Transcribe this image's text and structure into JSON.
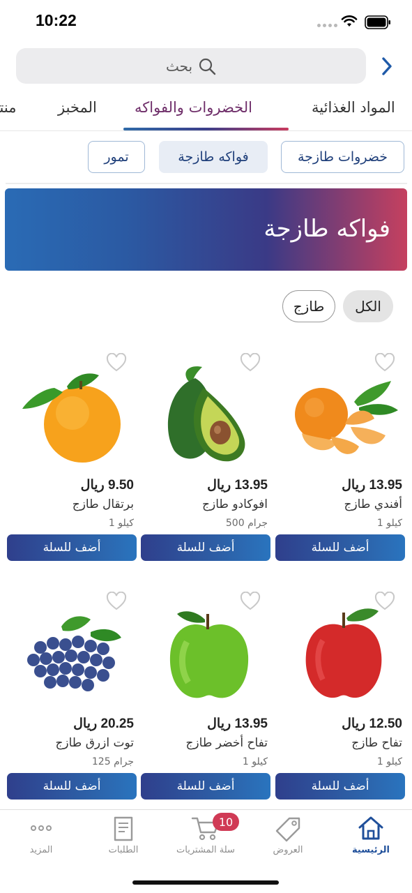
{
  "status_bar": {
    "time": "10:22"
  },
  "search": {
    "placeholder": "بحث"
  },
  "tabs": [
    {
      "label": "المواد الغذائية",
      "active": false
    },
    {
      "label": "الخضروات والفواكه",
      "active": true
    },
    {
      "label": "المخبز",
      "active": false
    },
    {
      "label": "منتج",
      "active": false
    }
  ],
  "subcategories": [
    {
      "label": "خضروات طازجة",
      "selected": false
    },
    {
      "label": "فواكه طازجة",
      "selected": true
    },
    {
      "label": "تمور",
      "selected": false
    }
  ],
  "banner": {
    "title": "فواكه طازجة"
  },
  "filters": {
    "all": "الكل",
    "fresh": "طازج"
  },
  "products": [
    {
      "name": "أفندي طازج",
      "price": "13.95 ريال",
      "qty": "1 كيلو",
      "image": "tangerine",
      "add_label": "أضف للسلة"
    },
    {
      "name": "افوكادو طازج",
      "price": "13.95 ريال",
      "qty": "500 جرام",
      "image": "avocado",
      "add_label": "أضف للسلة"
    },
    {
      "name": "برتقال طازج",
      "price": "9.50 ريال",
      "qty": "1 كيلو",
      "image": "orange",
      "add_label": "أضف للسلة"
    },
    {
      "name": "تفاح طازج",
      "price": "12.50 ريال",
      "qty": "1 كيلو",
      "image": "red-apple",
      "add_label": "أضف للسلة"
    },
    {
      "name": "تفاح أخضر طازج",
      "price": "13.95 ريال",
      "qty": "1 كيلو",
      "image": "green-apple",
      "add_label": "أضف للسلة"
    },
    {
      "name": "توت ازرق طازج",
      "price": "20.25 ريال",
      "qty": "125 جرام",
      "image": "blueberries",
      "add_label": "أضف للسلة"
    }
  ],
  "bottom_nav": {
    "items": [
      {
        "label": "الرئيسية",
        "icon": "home-icon",
        "active": true
      },
      {
        "label": "العروض",
        "icon": "tag-icon",
        "active": false
      },
      {
        "label": "سلة المشتريات",
        "icon": "cart-icon",
        "active": false
      },
      {
        "label": "الطلبات",
        "icon": "receipt-icon",
        "active": false
      },
      {
        "label": "المزيد",
        "icon": "more-icon",
        "active": false
      }
    ],
    "cart_count": "10"
  },
  "colors": {
    "brand_blue": "#1f4f9a",
    "brand_red": "#c5405f",
    "badge": "#d03a55"
  }
}
